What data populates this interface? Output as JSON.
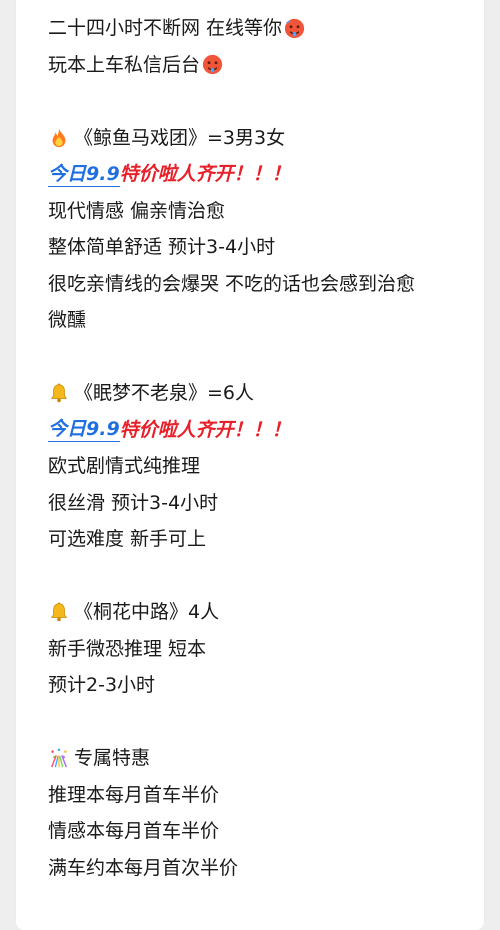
{
  "post": {
    "intro": {
      "line1": "二十四小时不断网 在线等你",
      "line2": "玩本上车私信后台"
    },
    "script1": {
      "title": "《鲸鱼马戏团》=3男3女",
      "promo_blue": "今日9.9",
      "promo_red": "特价啦人齐开！！！",
      "desc": [
        "现代情感 偏亲情治愈",
        "整体简单舒适 预计3-4小时",
        "很吃亲情线的会爆哭 不吃的话也会感到治愈",
        "微醺"
      ],
      "icon": "fire-emoji"
    },
    "script2": {
      "title": "《眠梦不老泉》=6人",
      "promo_blue": "今日9.9",
      "promo_red": "特价啦人齐开！！！",
      "desc": [
        "欧式剧情式纯推理",
        "很丝滑 预计3-4小时",
        "可选难度  新手可上"
      ],
      "icon": "bell-emoji"
    },
    "script3": {
      "title": "《桐花中路》4人",
      "desc": [
        "新手微恐推理 短本",
        "预计2-3小时"
      ],
      "icon": "bell-emoji"
    },
    "offers": {
      "title": "专属特惠",
      "items": [
        "推理本每月首车半价",
        "情感本每月首车半价",
        "满车约本每月首次半价"
      ],
      "icon": "confetti-emoji"
    }
  },
  "colors": {
    "text": "#1a1a1a",
    "promo_blue": "#1f6fe0",
    "promo_red": "#e8202a",
    "background": "#eeeeee",
    "card": "#ffffff"
  }
}
